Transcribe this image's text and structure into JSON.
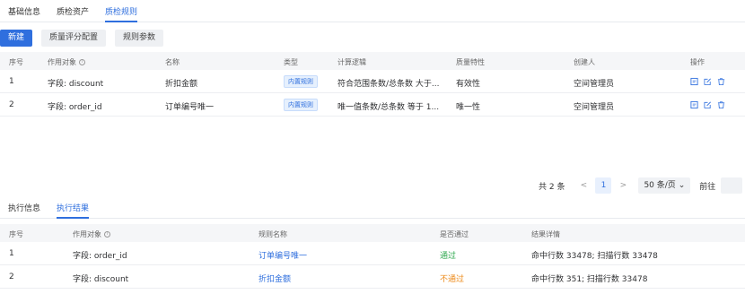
{
  "top_tabs": [
    "基础信息",
    "质检资产",
    "质检规则"
  ],
  "toolbar": {
    "new_label": "新建",
    "score_config_label": "质量评分配置",
    "params_label": "规则参数"
  },
  "rules_table": {
    "headers": [
      "序号",
      "作用对象",
      "名称",
      "类型",
      "计算逻辑",
      "质量特性",
      "创建人",
      "操作"
    ],
    "rows": [
      {
        "index": "1",
        "target": "字段: discount",
        "name": "折扣金额",
        "type": "内置规则",
        "logic": "符合范围条数/总条数 大于...",
        "trait": "有效性",
        "creator": "空间管理员"
      },
      {
        "index": "2",
        "target": "字段: order_id",
        "name": "订单编号唯一",
        "type": "内置规则",
        "logic": "唯一值条数/总条数 等于 1...",
        "trait": "唯一性",
        "creator": "空间管理员"
      }
    ]
  },
  "pagination": {
    "total": "共 2 条",
    "prev": "<",
    "current": "1",
    "next": ">",
    "page_size": "50 条/页",
    "goto_label": "前往"
  },
  "bottom_tabs": [
    "执行信息",
    "执行结果"
  ],
  "results_table": {
    "headers": [
      "序号",
      "作用对象",
      "规则名称",
      "是否通过",
      "结果详情"
    ],
    "rows": [
      {
        "index": "1",
        "target": "字段: order_id",
        "rule": "订单编号唯一",
        "status": "通过",
        "detail": "命中行数 33478; 扫描行数 33478"
      },
      {
        "index": "2",
        "target": "字段: discount",
        "rule": "折扣金额",
        "status": "不通过",
        "detail": "命中行数 351; 扫描行数 33478"
      }
    ]
  },
  "colors": {
    "accent": "#2f6fde",
    "pass": "#2fa84f",
    "fail": "#ed8a19"
  }
}
